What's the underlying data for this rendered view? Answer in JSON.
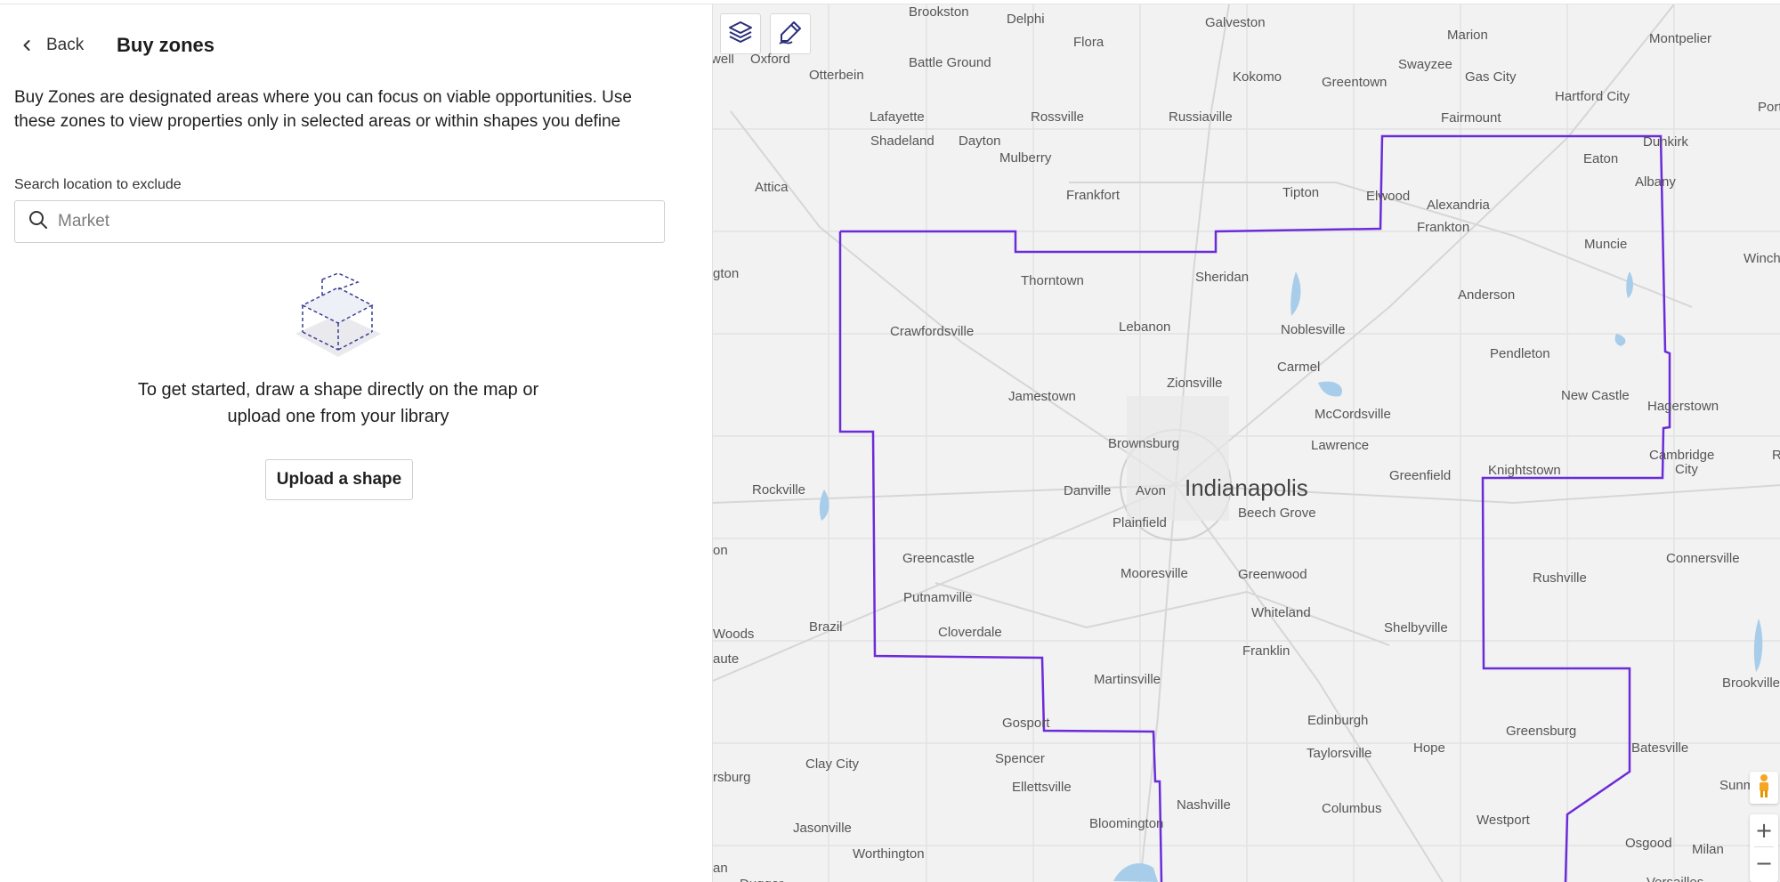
{
  "panel": {
    "back_label": "Back",
    "title": "Buy zones",
    "description": "Buy Zones are designated areas where you can focus on viable opportunities. Use these zones to view properties only in selected areas or within shapes you define",
    "search_label": "Search location to exclude",
    "search_placeholder": "Market",
    "search_value": "",
    "empty_line1": "To get started, draw a shape directly on the map or",
    "empty_line2": "upload one from your library",
    "upload_button": "Upload a shape"
  },
  "map": {
    "zoom_in": "+",
    "zoom_out": "−",
    "zone_color": "#6c2bd9",
    "cities": [
      {
        "name": "Brookston"
      },
      {
        "name": "Delphi"
      },
      {
        "name": "Galveston"
      },
      {
        "name": "Marion"
      },
      {
        "name": "Montpelier"
      },
      {
        "name": "Flora"
      },
      {
        "name": "well"
      },
      {
        "name": "Oxford"
      },
      {
        "name": "Battle Ground"
      },
      {
        "name": "Swayzee"
      },
      {
        "name": "Otterbein"
      },
      {
        "name": "Kokomo"
      },
      {
        "name": "Greentown"
      },
      {
        "name": "Gas City"
      },
      {
        "name": "Hartford City"
      },
      {
        "name": "Portla"
      },
      {
        "name": "Lafayette"
      },
      {
        "name": "Rossville"
      },
      {
        "name": "Russiaville"
      },
      {
        "name": "Fairmount"
      },
      {
        "name": "Shadeland"
      },
      {
        "name": "Dayton"
      },
      {
        "name": "Dunkirk"
      },
      {
        "name": "Mulberry"
      },
      {
        "name": "Eaton"
      },
      {
        "name": "Albany"
      },
      {
        "name": "Attica"
      },
      {
        "name": "Frankfort"
      },
      {
        "name": "Tipton"
      },
      {
        "name": "Elwood"
      },
      {
        "name": "Alexandria"
      },
      {
        "name": "Frankton"
      },
      {
        "name": "Muncie"
      },
      {
        "name": "Winches"
      },
      {
        "name": "gton"
      },
      {
        "name": "Thorntown"
      },
      {
        "name": "Sheridan"
      },
      {
        "name": "Anderson"
      },
      {
        "name": "Lebanon"
      },
      {
        "name": "Noblesville"
      },
      {
        "name": "Crawfordsville"
      },
      {
        "name": "Pendleton"
      },
      {
        "name": "Carmel"
      },
      {
        "name": "Zionsville"
      },
      {
        "name": "Jamestown"
      },
      {
        "name": "New Castle"
      },
      {
        "name": "McCordsville"
      },
      {
        "name": "Hagerstown"
      },
      {
        "name": "Brownsburg"
      },
      {
        "name": "Lawrence"
      },
      {
        "name": "Cambridge"
      },
      {
        "name": "City"
      },
      {
        "name": "R"
      },
      {
        "name": "Knightstown"
      },
      {
        "name": "Rockville"
      },
      {
        "name": "Danville"
      },
      {
        "name": "Avon"
      },
      {
        "name": "Indianapolis"
      },
      {
        "name": "Greenfield"
      },
      {
        "name": "Beech Grove"
      },
      {
        "name": "Plainfield"
      },
      {
        "name": "on"
      },
      {
        "name": "Greencastle"
      },
      {
        "name": "Connersville"
      },
      {
        "name": "Mooresville"
      },
      {
        "name": "Greenwood"
      },
      {
        "name": "Rushville"
      },
      {
        "name": "Putnamville"
      },
      {
        "name": "Whiteland"
      },
      {
        "name": "Woods"
      },
      {
        "name": "Brazil"
      },
      {
        "name": "Cloverdale"
      },
      {
        "name": "Shelbyville"
      },
      {
        "name": "aute"
      },
      {
        "name": "Franklin"
      },
      {
        "name": "Martinsville"
      },
      {
        "name": "Brookville"
      },
      {
        "name": "Gosport"
      },
      {
        "name": "Edinburgh"
      },
      {
        "name": "Greensburg"
      },
      {
        "name": "Hope"
      },
      {
        "name": "Spencer"
      },
      {
        "name": "Taylorsville"
      },
      {
        "name": "Batesville"
      },
      {
        "name": "Clay City"
      },
      {
        "name": "rsburg"
      },
      {
        "name": "Ellettsville"
      },
      {
        "name": "Sunman"
      },
      {
        "name": "Nashville"
      },
      {
        "name": "Columbus"
      },
      {
        "name": "Bloomington"
      },
      {
        "name": "Westport"
      },
      {
        "name": "Jasonville"
      },
      {
        "name": "Osgood"
      },
      {
        "name": "Milan"
      },
      {
        "name": "Worthington"
      },
      {
        "name": "an"
      },
      {
        "name": "Dugger"
      },
      {
        "name": "Versailles"
      }
    ]
  }
}
